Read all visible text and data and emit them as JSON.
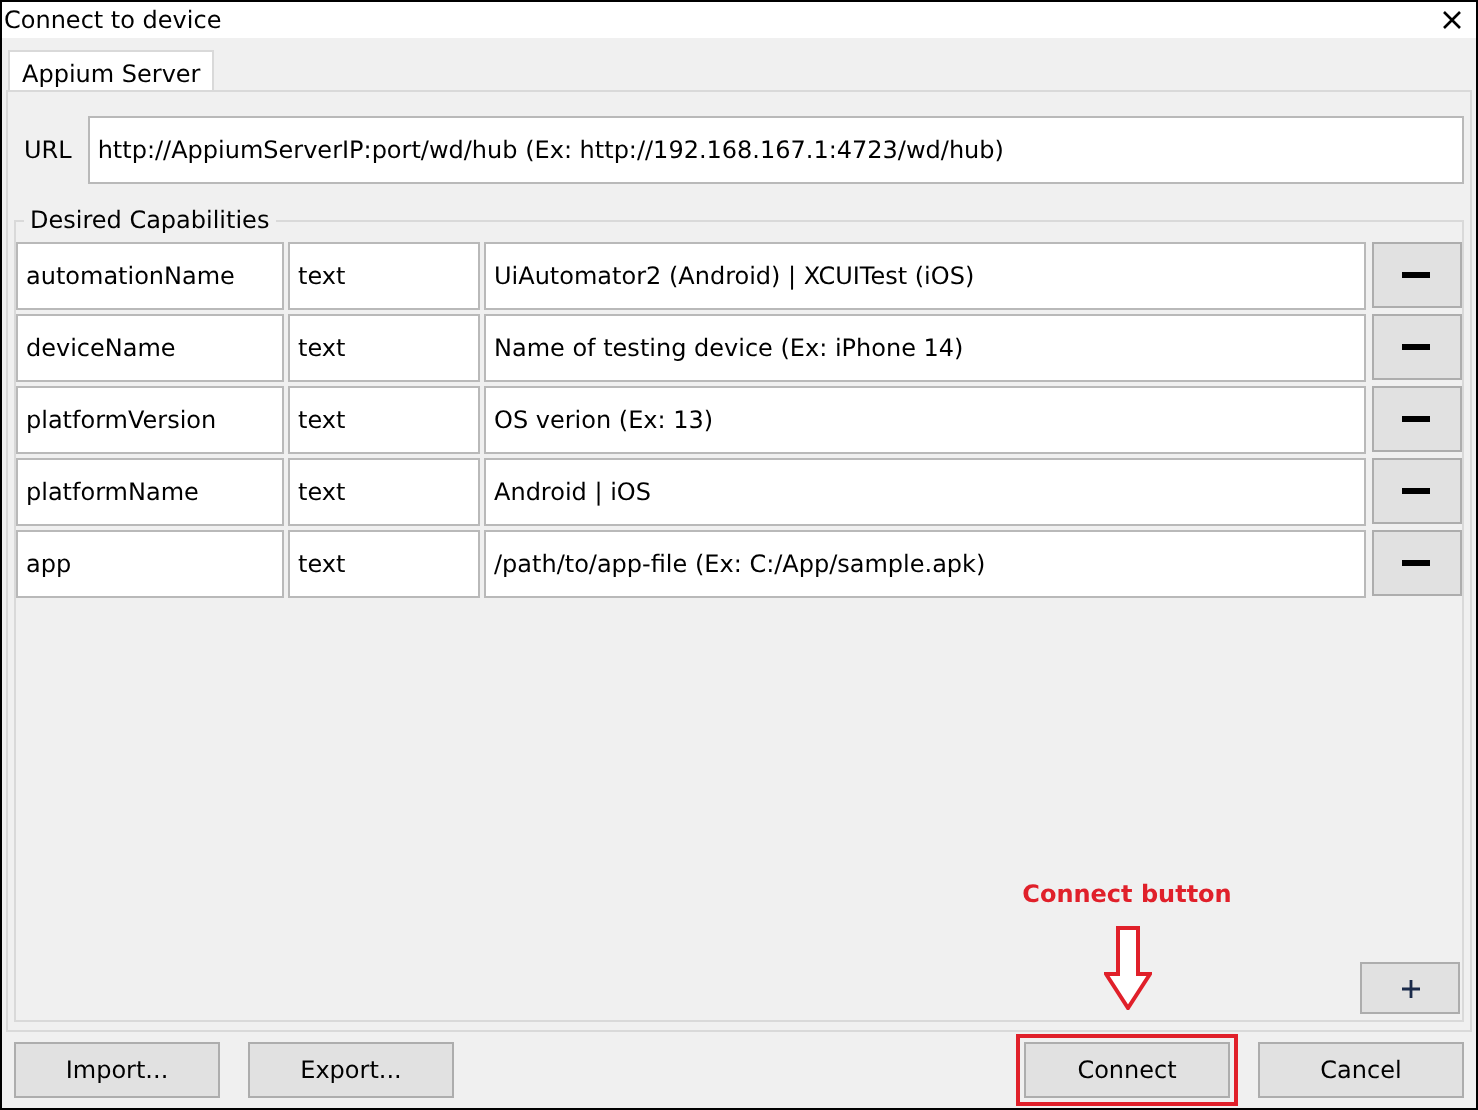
{
  "window": {
    "title": "Connect to device"
  },
  "tabs": [
    {
      "label": "Appium Server",
      "selected": true
    }
  ],
  "url": {
    "label": "URL",
    "value": "http://AppiumServerIP:port/wd/hub (Ex: http://192.168.167.1:4723/wd/hub)"
  },
  "capabilities": {
    "title": "Desired Capabilities",
    "rows": [
      {
        "name": "automationName",
        "type": "text",
        "value": "UiAutomator2 (Android) | XCUITest (iOS)"
      },
      {
        "name": "deviceName",
        "type": "text",
        "value": "Name of testing device (Ex: iPhone 14)"
      },
      {
        "name": "platformVersion",
        "type": "text",
        "value": "OS verion (Ex: 13)"
      },
      {
        "name": "platformName",
        "type": "text",
        "value": "Android | iOS"
      },
      {
        "name": "app",
        "type": "text",
        "value": "/path/to/app-file (Ex: C:/App/sample.apk)"
      }
    ]
  },
  "left_buttons": [
    {
      "label": "Import...",
      "highlighted": false
    },
    {
      "label": "Export...",
      "highlighted": false
    }
  ],
  "right_buttons": [
    {
      "label": "Connect",
      "highlighted": true
    },
    {
      "label": "Cancel",
      "highlighted": false
    }
  ],
  "annotation": {
    "text": "Connect button"
  }
}
